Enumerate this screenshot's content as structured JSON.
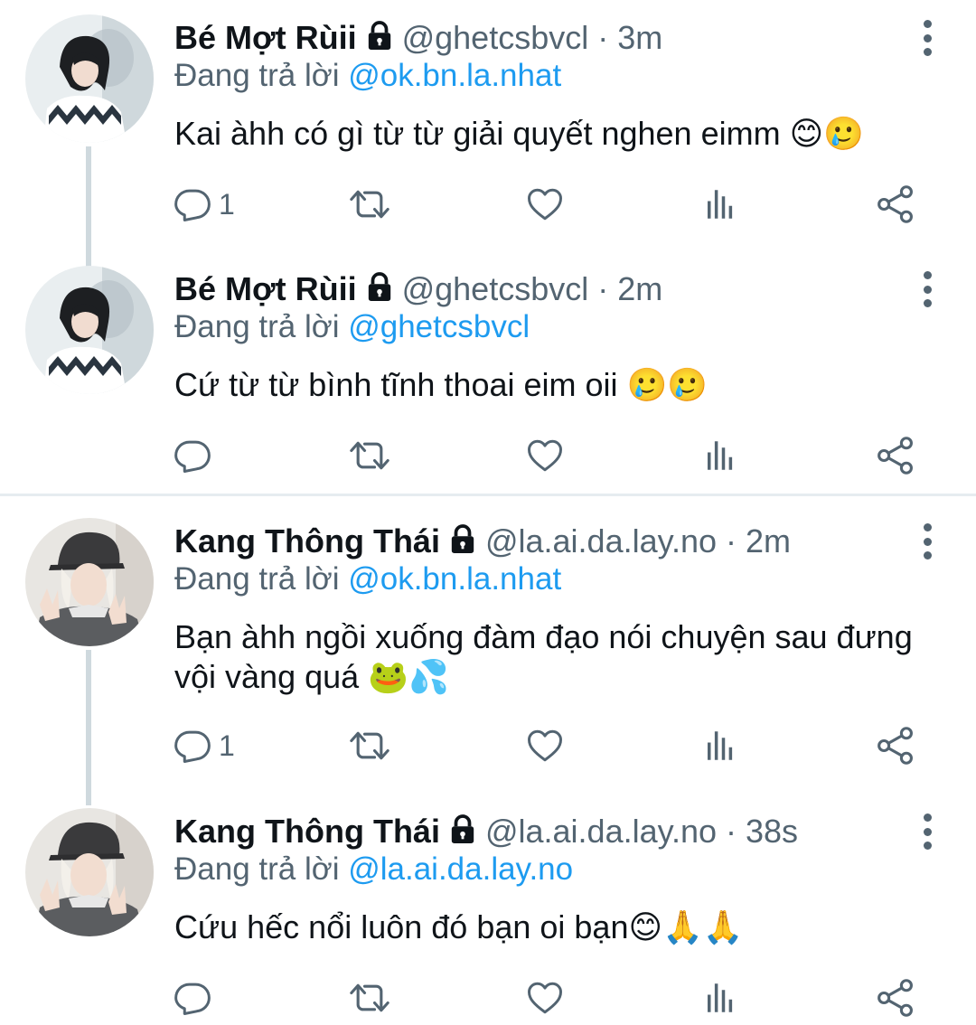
{
  "colors": {
    "text": "#0f1419",
    "secondary": "#536471",
    "mention": "#1d9bf0",
    "thread_line": "#cfd9de"
  },
  "tweets": [
    {
      "name": "Bé Mợt Rùii",
      "lock_icon": "lock-icon",
      "handle": "@ghetcsbvcl",
      "dot": "·",
      "time": "3m",
      "replying_prefix": "Đang trả lời",
      "replying_to": "@ok.bn.la.nhat",
      "text": "Kai àhh có gì từ từ giải quyết nghen eimm 😊🥲",
      "reply_count": "1"
    },
    {
      "name": "Bé Mợt Rùii",
      "lock_icon": "lock-icon",
      "handle": "@ghetcsbvcl",
      "dot": "·",
      "time": "2m",
      "replying_prefix": "Đang trả lời",
      "replying_to": "@ghetcsbvcl",
      "text": "Cứ từ từ bình tĩnh thoai eim oii 🥲🥲",
      "reply_count": ""
    },
    {
      "name": "Kang Thông Thái",
      "lock_icon": "lock-icon",
      "handle": "@la.ai.da.lay.no",
      "dot": "·",
      "time": "2m",
      "replying_prefix": "Đang trả lời",
      "replying_to": "@ok.bn.la.nhat",
      "text": "Bạn àhh ngồi xuống đàm đạo nói chuyện sau đưng vội vàng quá 🐸💦",
      "reply_count": "1"
    },
    {
      "name": "Kang Thông Thái",
      "lock_icon": "lock-icon",
      "handle": "@la.ai.da.lay.no",
      "dot": "·",
      "time": "38s",
      "replying_prefix": "Đang trả lời",
      "replying_to": "@la.ai.da.lay.no",
      "text": "Cứu hếc nổi luôn đó bạn oi bạn😊🙏🙏",
      "reply_count": ""
    }
  ]
}
